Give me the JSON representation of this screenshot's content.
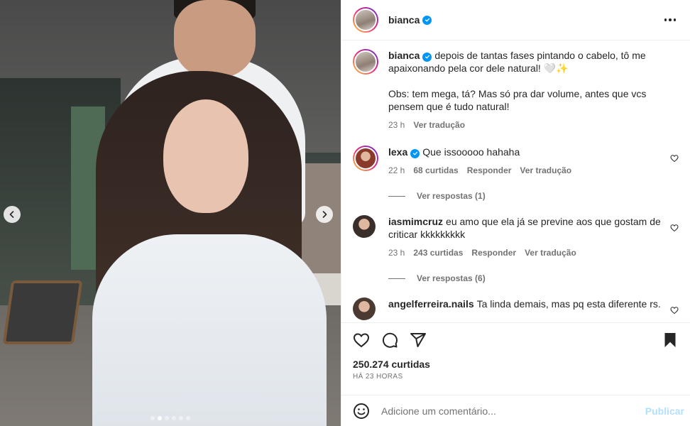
{
  "post": {
    "author": "bianca",
    "verified": true,
    "caption_line1": "depois de tantas fases pintando o cabelo, tô me apaixonando pela cor dele natural! 🤍✨",
    "caption_line2": "Obs: tem mega, tá? Mas só pra dar volume, antes que vcs pensem que é tudo natural!",
    "caption_time": "23 h",
    "caption_translate": "Ver tradução",
    "likes": "250.274 curtidas",
    "posted_ago": "Há 23 horas",
    "carousel": {
      "slides": 6,
      "active_index": 1
    }
  },
  "comments": [
    {
      "username": "lexa",
      "verified": true,
      "text": "Que issooooo hahaha",
      "time": "22 h",
      "likes": "68 curtidas",
      "reply": "Responder",
      "translate": "Ver tradução",
      "replies_label": "Ver respostas (1)",
      "avatar_color": "#8a3a2a"
    },
    {
      "username": "iasmimcruz",
      "verified": false,
      "text": "eu amo que ela já se previne aos que gostam de criticar kkkkkkkkk",
      "time": "23 h",
      "likes": "243 curtidas",
      "reply": "Responder",
      "translate": "Ver tradução",
      "replies_label": "Ver respostas (6)",
      "avatar_color": "#3a2e2a"
    },
    {
      "username": "angelferreira.nails",
      "verified": false,
      "text": "Ta linda demais, mas pq esta diferente rs.",
      "avatar_color": "#4a3a32"
    }
  ],
  "add_comment": {
    "placeholder": "Adicione um comentário...",
    "publish_label": "Publicar"
  },
  "icons": {
    "like": "heart-icon",
    "comment": "comment-icon",
    "share": "send-icon",
    "save": "bookmark-filled-icon",
    "emoji": "emoji-icon",
    "options": "more-options-icon"
  },
  "colors": {
    "verified": "#0095f6",
    "muted_text": "#737373",
    "publish_disabled": "#b2dffc"
  }
}
